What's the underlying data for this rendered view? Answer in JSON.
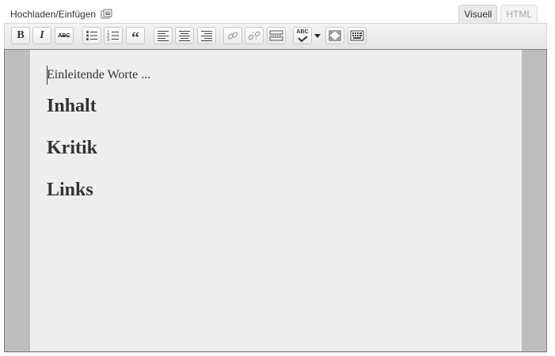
{
  "topbar": {
    "upload_label": "Hochladen/Einfügen",
    "upload_icon": "media-upload-icon",
    "tabs": [
      {
        "label": "Visuell",
        "active": true
      },
      {
        "label": "HTML",
        "active": false
      }
    ]
  },
  "toolbar": {
    "buttons": [
      {
        "name": "bold-button",
        "icon": "bold-icon",
        "glyph": "B"
      },
      {
        "name": "italic-button",
        "icon": "italic-icon",
        "glyph": "I"
      },
      {
        "name": "strikethrough-button",
        "icon": "strikethrough-icon",
        "glyph": "ABC"
      },
      {
        "name": "bullet-list-button",
        "icon": "bullet-list-icon"
      },
      {
        "name": "numbered-list-button",
        "icon": "numbered-list-icon"
      },
      {
        "name": "blockquote-button",
        "icon": "blockquote-icon",
        "glyph": "“"
      },
      {
        "name": "align-left-button",
        "icon": "align-left-icon"
      },
      {
        "name": "align-center-button",
        "icon": "align-center-icon"
      },
      {
        "name": "align-right-button",
        "icon": "align-right-icon"
      },
      {
        "name": "insert-link-button",
        "icon": "link-icon"
      },
      {
        "name": "remove-link-button",
        "icon": "unlink-icon"
      },
      {
        "name": "insert-more-button",
        "icon": "more-tag-icon"
      },
      {
        "name": "spellcheck-button",
        "icon": "spellcheck-icon",
        "glyph": "ABC"
      },
      {
        "name": "fullscreen-button",
        "icon": "fullscreen-icon"
      },
      {
        "name": "kitchen-sink-button",
        "icon": "kitchen-sink-icon"
      }
    ]
  },
  "content": {
    "paragraph": "Einleitende Worte ...",
    "headings": [
      "Inhalt",
      "Kritik",
      "Links"
    ]
  }
}
